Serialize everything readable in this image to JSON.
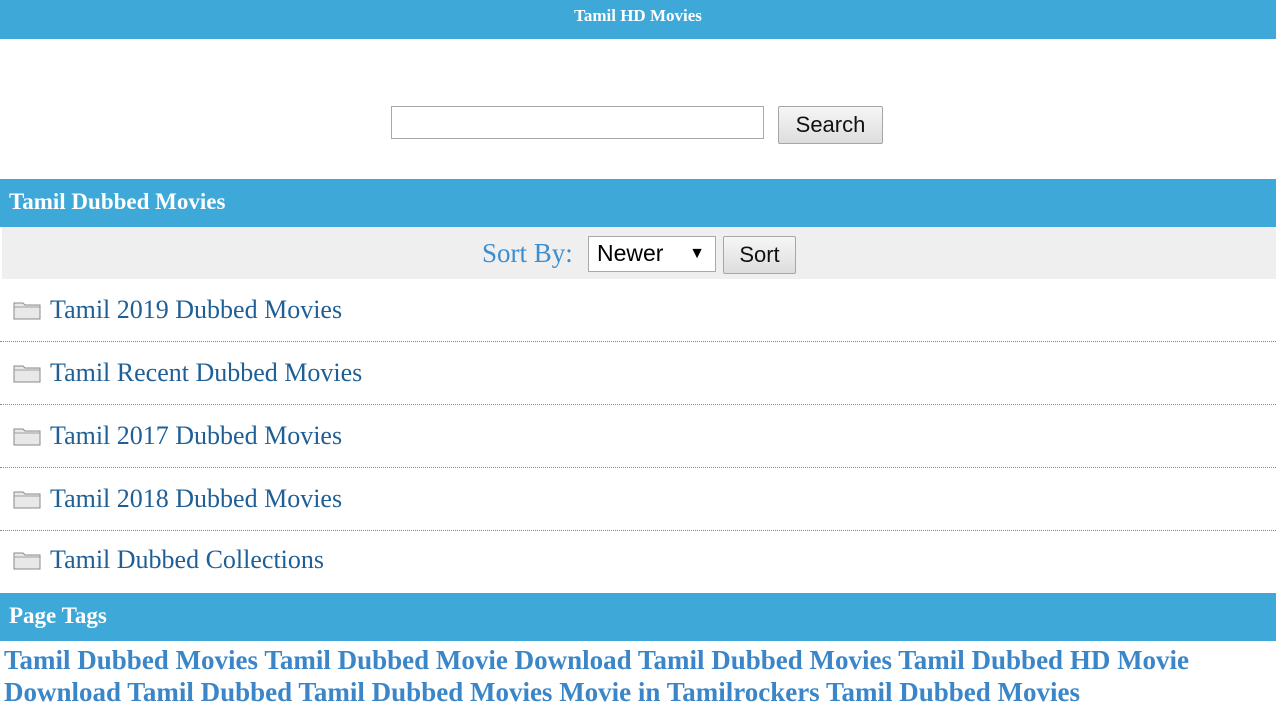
{
  "header": {
    "title": "Tamil HD Movies"
  },
  "search": {
    "value": "",
    "placeholder": "",
    "button_label": "Search"
  },
  "section": {
    "title": "Tamil Dubbed Movies"
  },
  "sort": {
    "label": "Sort By:",
    "selected": "Newer",
    "button_label": "Sort"
  },
  "categories": [
    {
      "label": "Tamil 2019 Dubbed Movies",
      "icon": "folder-icon"
    },
    {
      "label": "Tamil Recent Dubbed Movies",
      "icon": "folder-icon"
    },
    {
      "label": "Tamil 2017 Dubbed Movies",
      "icon": "folder-icon"
    },
    {
      "label": "Tamil 2018 Dubbed Movies",
      "icon": "folder-icon"
    },
    {
      "label": "Tamil Dubbed Collections",
      "icon": "folder-icon"
    }
  ],
  "tags": {
    "title": "Page Tags",
    "items": [
      "Tamil Dubbed Movies",
      "Tamil Dubbed Movie Download",
      "Tamil Dubbed Movies",
      "Tamil Dubbed HD Movie Download",
      "Tamil Dubbed",
      "Tamil Dubbed Movies Movie in Tamilrockers",
      "Tamil Dubbed Movies"
    ]
  },
  "colors": {
    "header_bg": "#3ea8d8",
    "link": "#1f5f96",
    "tag_link": "#3a86c8",
    "sort_bar_bg": "#efefef"
  }
}
